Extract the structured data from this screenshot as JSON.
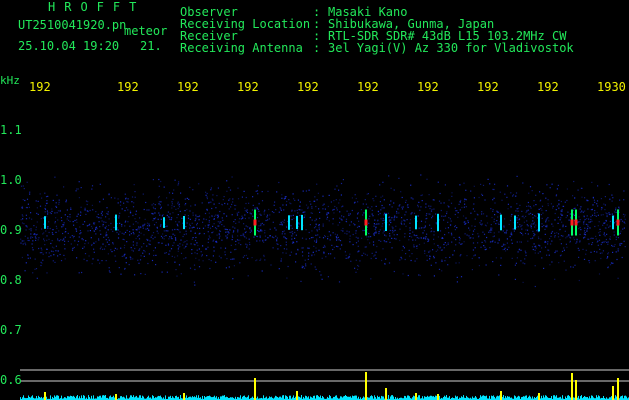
{
  "header": {
    "brand": "HROFFT",
    "filename": "UT2510041920.pn",
    "overlay": "meteor",
    "datetime": "25.10.04 19:20",
    "count": "21.",
    "fields": [
      {
        "label": "Observer",
        "value": "Masaki Kano"
      },
      {
        "label": "Receiving Location",
        "value": "Shibukawa, Gunma, Japan"
      },
      {
        "label": "Receiver",
        "value": "RTL-SDR SDR# 43dB L15 103.2MHz CW"
      },
      {
        "label": "Receiving Antenna",
        "value": "3el Yagi(V) Az 330 for Vladivostok"
      }
    ],
    "separator": ":"
  },
  "chart_data": {
    "type": "heatmap",
    "yunit": "kHz",
    "x_tick_labels": [
      "192",
      "192",
      "192",
      "192",
      "192",
      "192",
      "192",
      "192",
      "192",
      "1930"
    ],
    "y_tick_labels": [
      "1.1",
      "1.0",
      "0.9",
      "0.8",
      "0.7",
      "0.6"
    ],
    "y_ticks": [
      1.1,
      1.0,
      0.9,
      0.8,
      0.7,
      0.6
    ],
    "ylim": [
      0.58,
      1.15
    ],
    "band_kHz": [
      0.83,
      0.98
    ],
    "meteor_echoes_kHz": 0.915,
    "colors": {
      "noise": "#1a2fd0",
      "echo_low": "#00e5ff",
      "echo_mid": "#00ff66",
      "echo_high": "#ff2020",
      "histogram": "#00e5ff",
      "histogram_peak": "#ffff00",
      "hline": "#d0d0d0",
      "axis_text": "#22e85a",
      "time_text": "#f2f200"
    }
  }
}
